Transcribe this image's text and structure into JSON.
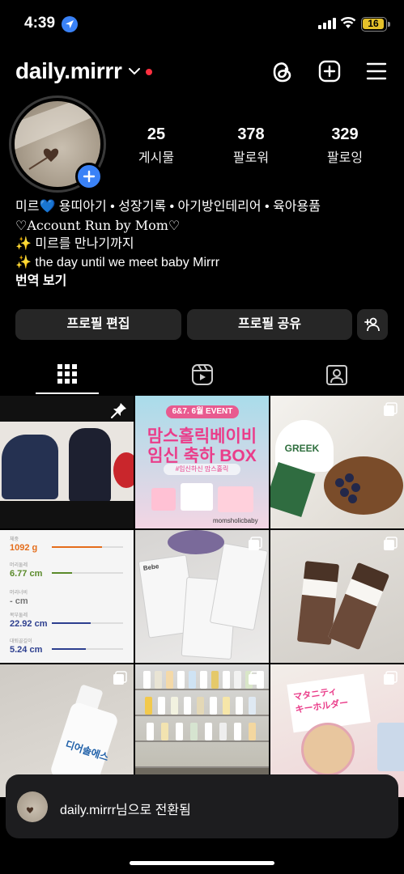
{
  "status_bar": {
    "time": "4:39",
    "battery": "16"
  },
  "header": {
    "username": "daily.mirrr"
  },
  "profile": {
    "stats": [
      {
        "value": "25",
        "label": "게시물"
      },
      {
        "value": "378",
        "label": "팔로워"
      },
      {
        "value": "329",
        "label": "팔로잉"
      }
    ],
    "bio": {
      "line1": "미르💙 용띠아기 • 성장기록 • 아기방인테리어 • 육아용품",
      "line2": "♡Account Run by Mom♡",
      "line3": "✨ 미르를 만나기까지",
      "line4": "✨ the day until we meet baby Mirrr",
      "translate": "번역 보기"
    }
  },
  "buttons": {
    "edit": "프로필 편집",
    "share": "프로필 공유"
  },
  "grid": {
    "post2": {
      "badge": "6&7. 6월 EVENT",
      "title1": "맘스홀릭베이비",
      "title2": "임신 축하 BOX",
      "sub": "#임신하신 맘스홀릭",
      "watermark": "momsholicbaby"
    },
    "post3": {
      "label": "GREEK"
    },
    "post4": {
      "rows": [
        {
          "label": "체중",
          "value": "1092 g"
        },
        {
          "label": "머리둘레",
          "value": "6.77 cm"
        },
        {
          "label": "머리너비",
          "value": "- cm"
        },
        {
          "label": "복부둘레",
          "value": "22.92 cm"
        },
        {
          "label": "대퇴골길이",
          "value": "5.24 cm"
        }
      ]
    },
    "post5": {
      "label": "Bebe"
    },
    "post7": {
      "label": "디어솔에스"
    },
    "post9": {
      "line1": "マタニティ",
      "line2": "キーホルダー"
    }
  },
  "toast": {
    "text": "daily.mirrr님으로 전환됨"
  },
  "colors": {
    "accent": "#3a82f7",
    "notification": "#ff3040",
    "button_bg": "#262626"
  }
}
